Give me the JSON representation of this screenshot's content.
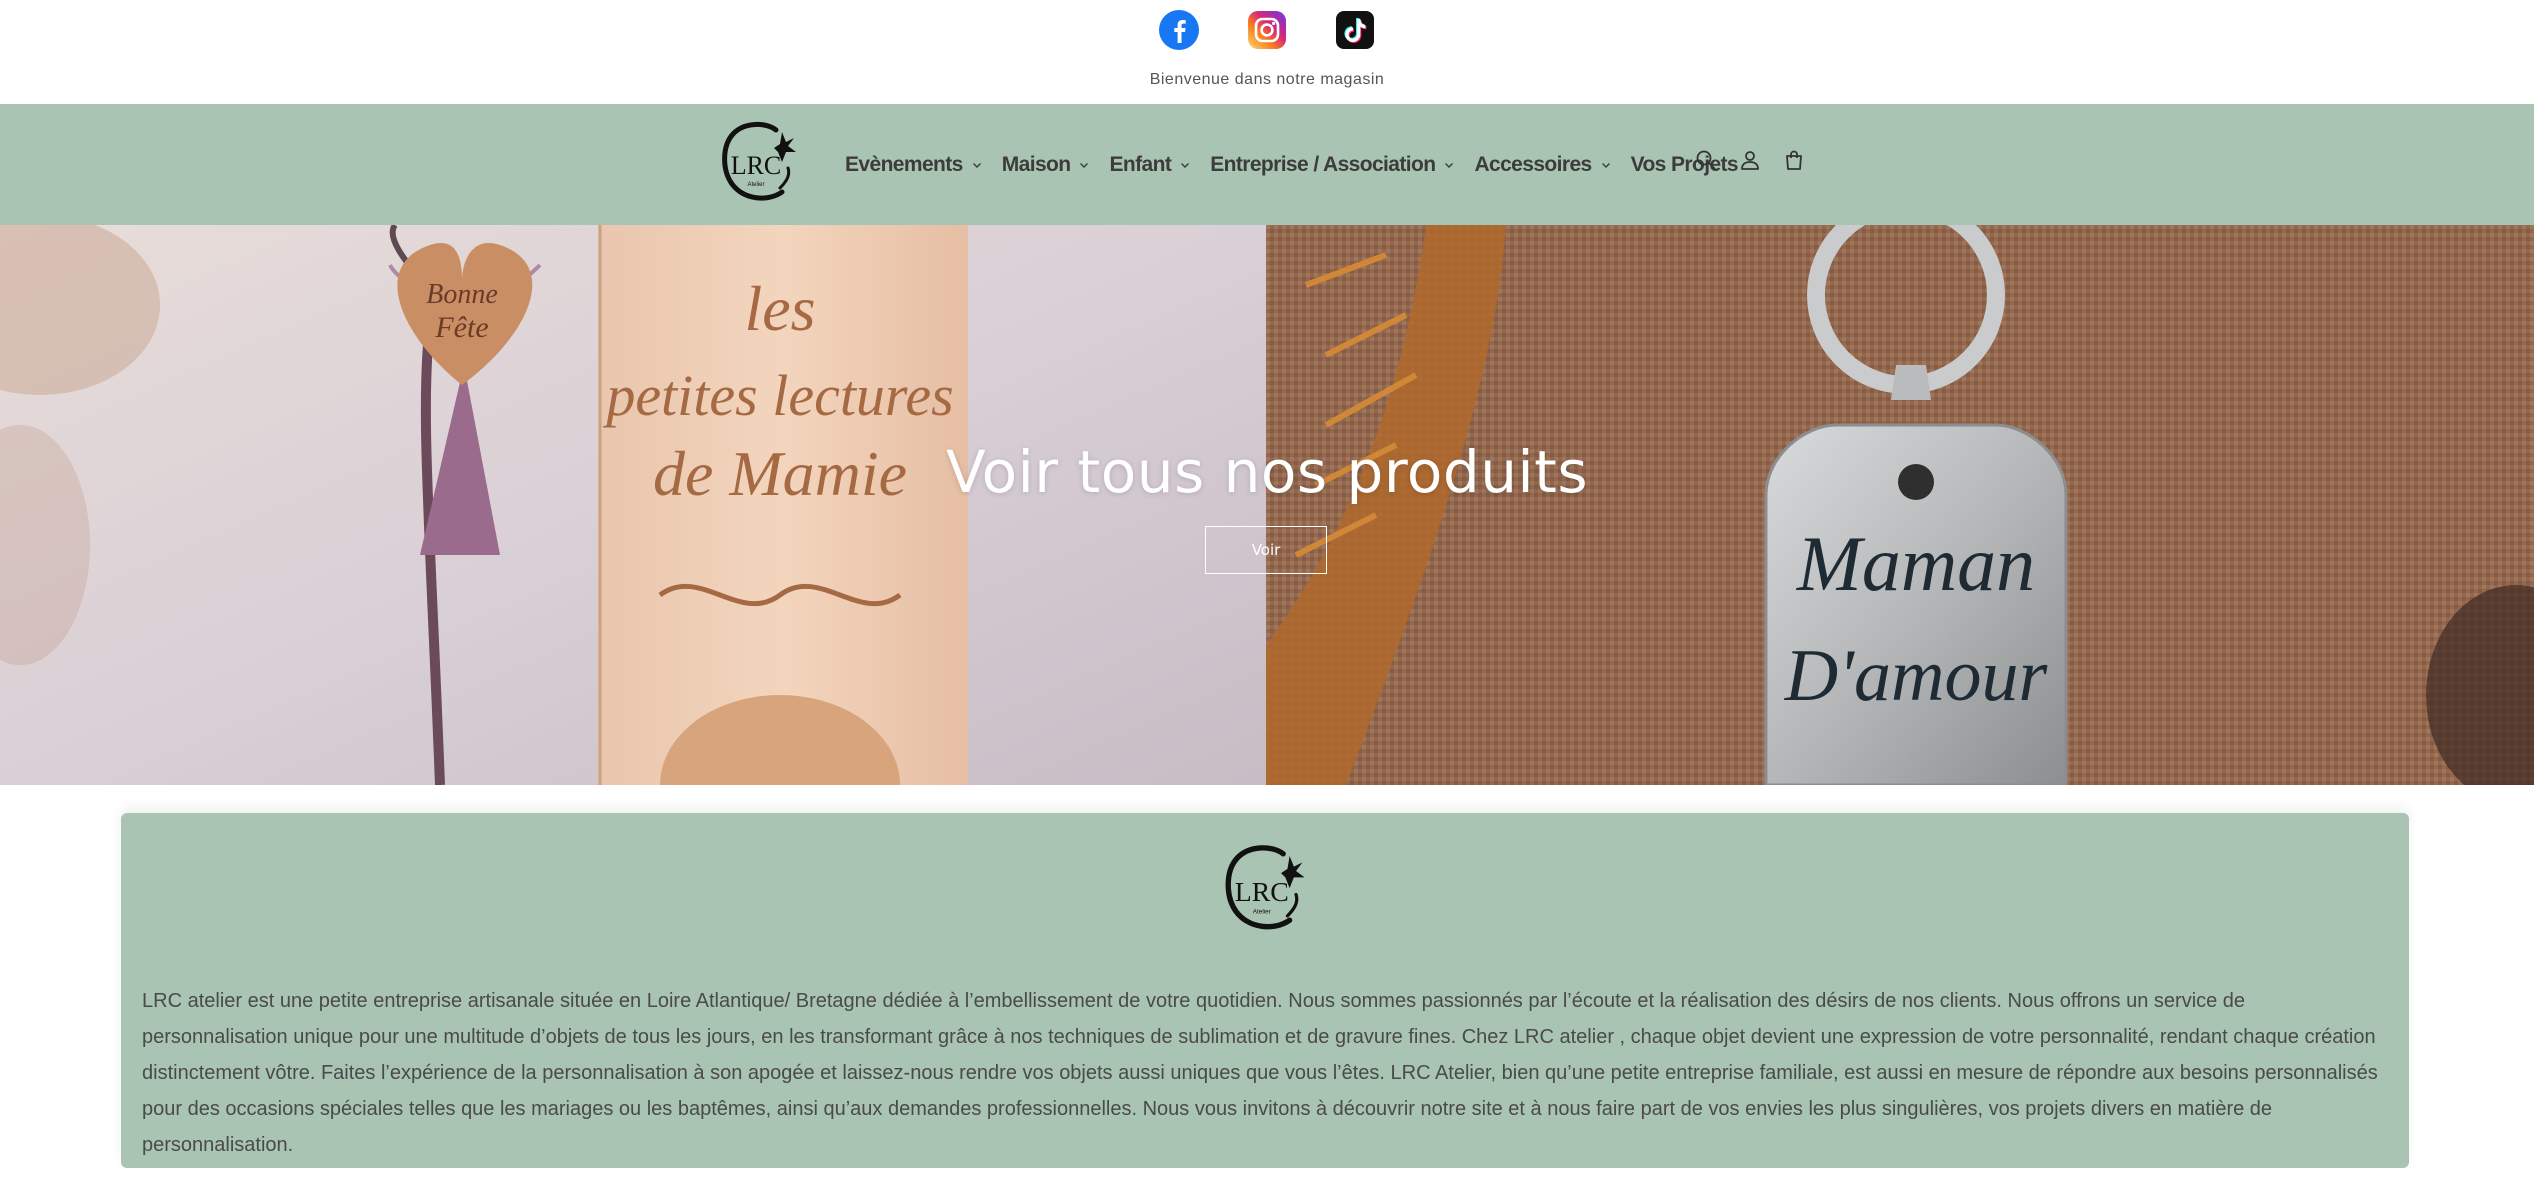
{
  "socials": [
    {
      "icon": "facebook-icon",
      "color": "#1877f2"
    },
    {
      "icon": "instagram-icon",
      "color": "#d6249f"
    },
    {
      "icon": "tiktok-icon",
      "color": "#000000"
    }
  ],
  "announcement": "Bienvenue dans notre magasin",
  "header": {
    "bg_color": "#a9c4b3",
    "logo_text": "LRC",
    "logo_subtext": "Atelier",
    "nav": [
      {
        "label": "Evènements",
        "dropdown": true
      },
      {
        "label": "Maison",
        "dropdown": true
      },
      {
        "label": "Enfant",
        "dropdown": true
      },
      {
        "label": "Entreprise / Association",
        "dropdown": true
      },
      {
        "label": "Accessoires",
        "dropdown": true
      },
      {
        "label": "Vos Projets",
        "dropdown": false
      }
    ],
    "icons": [
      "search-icon",
      "account-icon",
      "cart-icon"
    ]
  },
  "hero": {
    "title": "Voir tous nos produits",
    "button_label": "Voir",
    "left_image": {
      "line1": "les",
      "line2": "petites lectures",
      "line3": "de Mamie",
      "tag_line1": "Bonne",
      "tag_line2": "Fête"
    },
    "right_image": {
      "line1": "Maman",
      "line2": "D'amour"
    }
  },
  "about": {
    "logo_text": "LRC",
    "logo_subtext": "Atelier",
    "text": "LRC atelier est une petite entreprise artisanale située en Loire Atlantique/ Bretagne dédiée à l’embellissement de votre quotidien. Nous sommes passionnés par l’écoute et la réalisation des désirs de nos clients. Nous offrons un service de personnalisation unique pour une multitude d’objets de tous les jours, en les transformant grâce à nos techniques de sublimation et de gravure fines. Chez LRC atelier , chaque objet devient une expression de votre personnalité, rendant chaque création distinctement vôtre. Faites l’expérience de la personnalisation à son apogée et laissez-nous rendre vos objets aussi uniques que vous l’êtes. LRC Atelier, bien qu’une petite entreprise familiale, est aussi en mesure de répondre aux besoins personnalisés pour des occasions spéciales telles que les mariages ou les baptêmes, ainsi qu’aux demandes professionnelles. Nous vous invitons à découvrir notre site et à nous faire part de vos envies les plus singulières, vos projets divers en matière de personnalisation."
  }
}
